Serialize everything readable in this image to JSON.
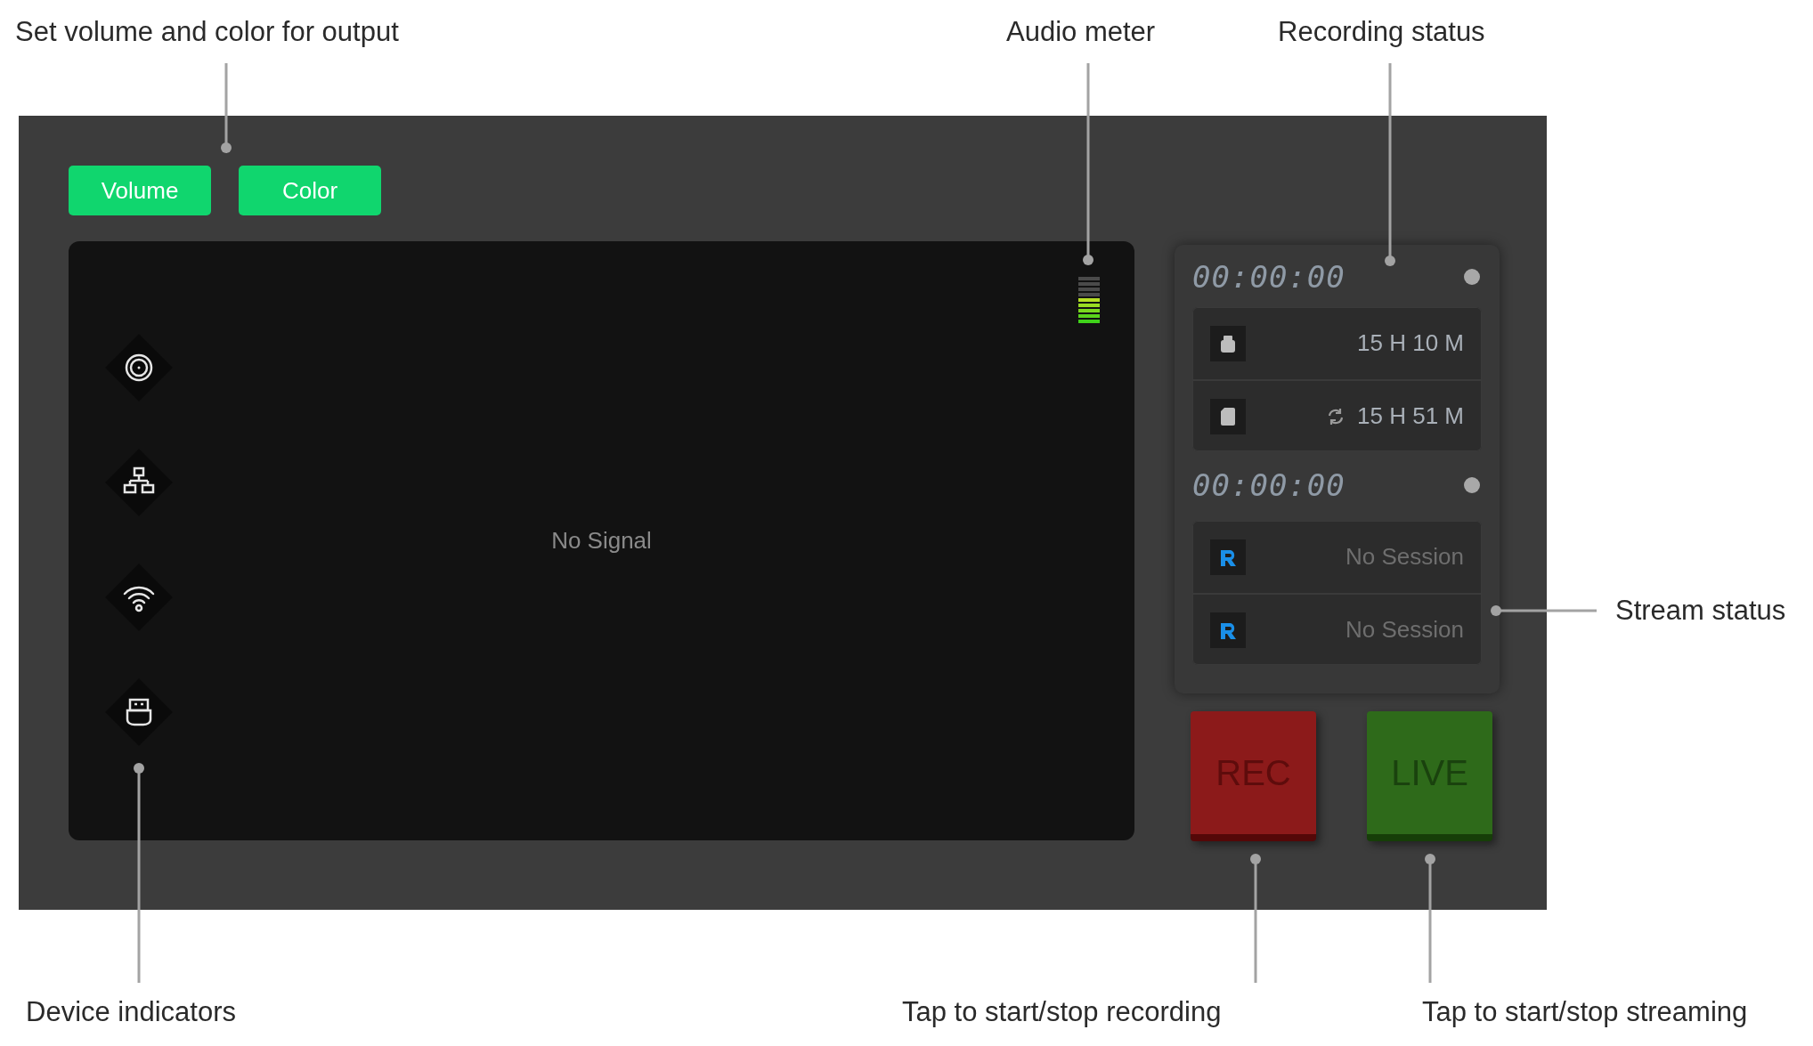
{
  "annotations": [
    {
      "text": "Set volume and color for output"
    },
    {
      "text": "Audio meter"
    },
    {
      "text": "Recording status"
    },
    {
      "text": "Stream status"
    },
    {
      "text": "Device indicators"
    },
    {
      "text": "Tap to start/stop recording"
    },
    {
      "text": "Tap to start/stop streaming"
    }
  ],
  "output_buttons": [
    {
      "label": "Volume"
    },
    {
      "label": "Color"
    }
  ],
  "preview": {
    "message": "No Signal"
  },
  "audio_meter": {
    "level": 0.56
  },
  "recording": {
    "timer": "00:00:00",
    "storage": [
      {
        "kind": "usb",
        "remaining": "15 H 10 M",
        "sync": false
      },
      {
        "kind": "sd",
        "remaining": "15 H 51 M",
        "sync": true
      }
    ]
  },
  "stream": {
    "timer": "00:00:00",
    "sessions": [
      {
        "status": "No Session"
      },
      {
        "status": "No Session"
      }
    ]
  },
  "rec_button": {
    "label": "REC"
  },
  "live_button": {
    "label": "LIVE"
  }
}
